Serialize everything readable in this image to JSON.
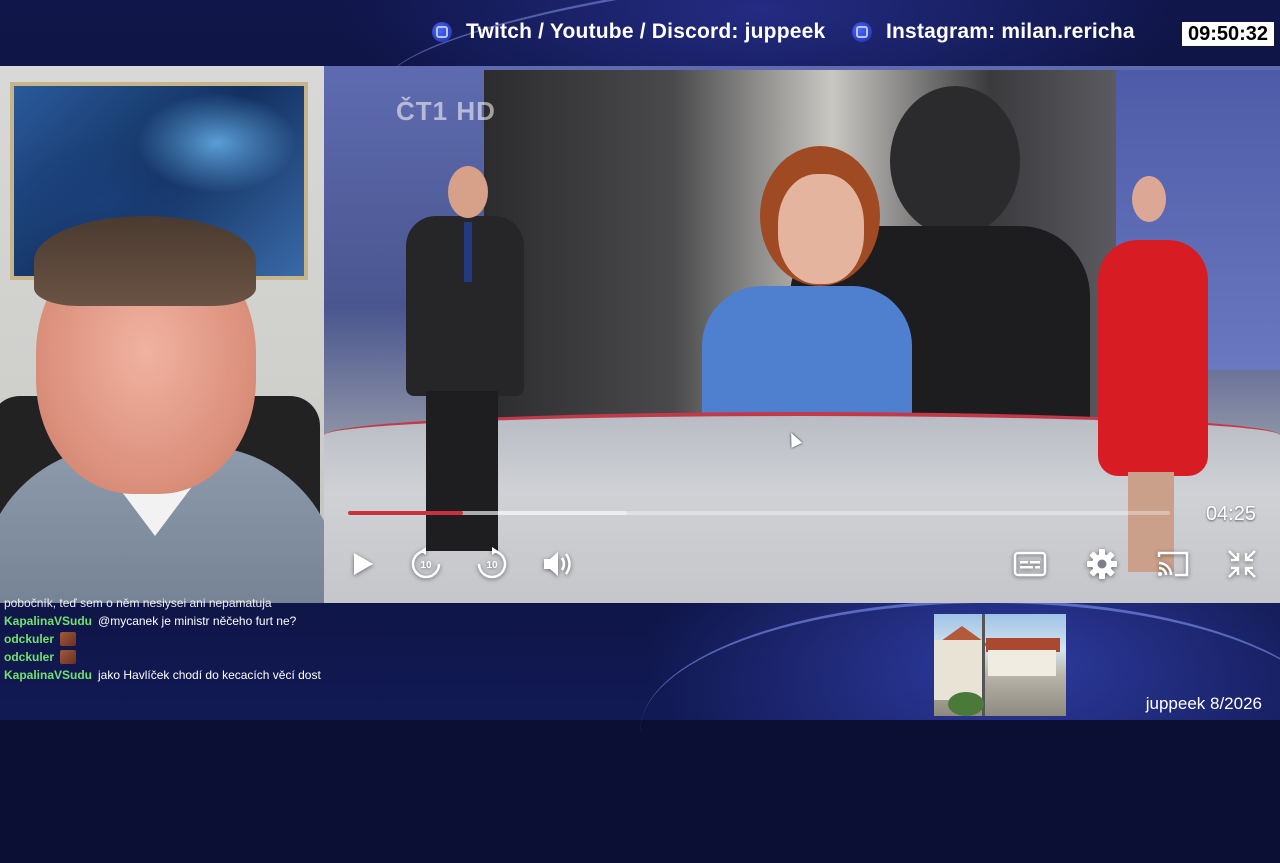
{
  "header": {
    "social_left": "Twitch / Youtube / Discord: juppeek",
    "social_right": "Instagram: milan.rericha",
    "clock": "09:50:32"
  },
  "player": {
    "channel_logo": "ČT1 HD",
    "time_remaining": "04:25",
    "progress_played_fraction": 0.14,
    "progress_buffered_fraction": 0.34,
    "controls": {
      "play": "play-icon",
      "rewind": "rewind-10-icon",
      "forward": "forward-10-icon",
      "volume": "volume-icon",
      "subtitles": "subtitles-icon",
      "settings": "gear-icon",
      "cast": "cast-icon",
      "exit_fullscreen": "exit-fullscreen-icon"
    },
    "skip_seconds": "10",
    "accent_color": "#c8323e"
  },
  "chat": {
    "cut_line": "pobočník, teď sem o něm nesiysei ani nepamatuja",
    "messages": [
      {
        "user": "KapalinaVSudu",
        "text": "@mycanek je ministr něčeho furt ne?",
        "emote": false
      },
      {
        "user": "odckuler",
        "text": "",
        "emote": true
      },
      {
        "user": "odckuler",
        "text": "",
        "emote": true
      },
      {
        "user": "KapalinaVSudu",
        "text": "jako Havlíček chodí do kecacích věcí dost",
        "emote": false
      }
    ],
    "user_color": "#6ee36e"
  },
  "footer": {
    "tag": "juppeek 8/2026"
  }
}
